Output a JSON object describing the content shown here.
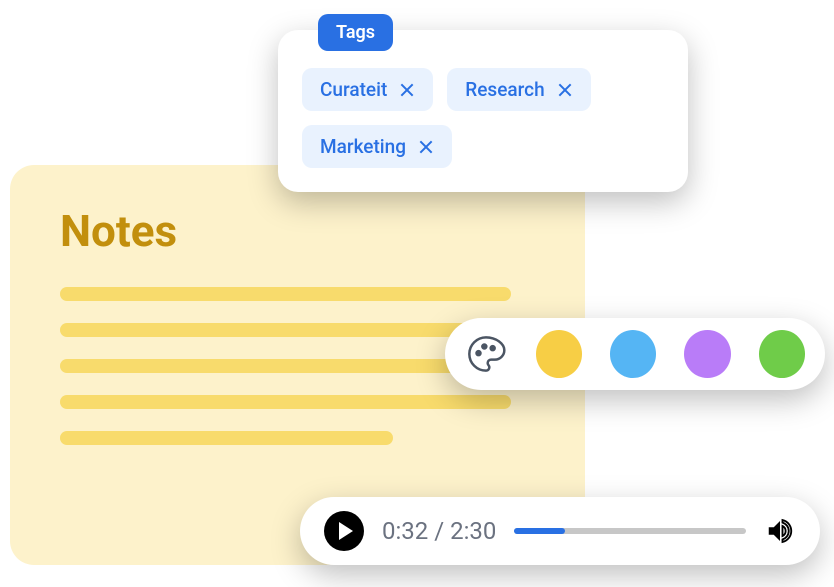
{
  "notes": {
    "title": "Notes"
  },
  "tags": {
    "label": "Tags",
    "items": [
      {
        "name": "Curateit"
      },
      {
        "name": "Research"
      },
      {
        "name": "Marketing"
      }
    ]
  },
  "colors": {
    "options": [
      "yellow",
      "blue",
      "purple",
      "green"
    ]
  },
  "audio": {
    "current": "0:32",
    "separator": " / ",
    "total": "2:30",
    "progress_percent": 22
  }
}
